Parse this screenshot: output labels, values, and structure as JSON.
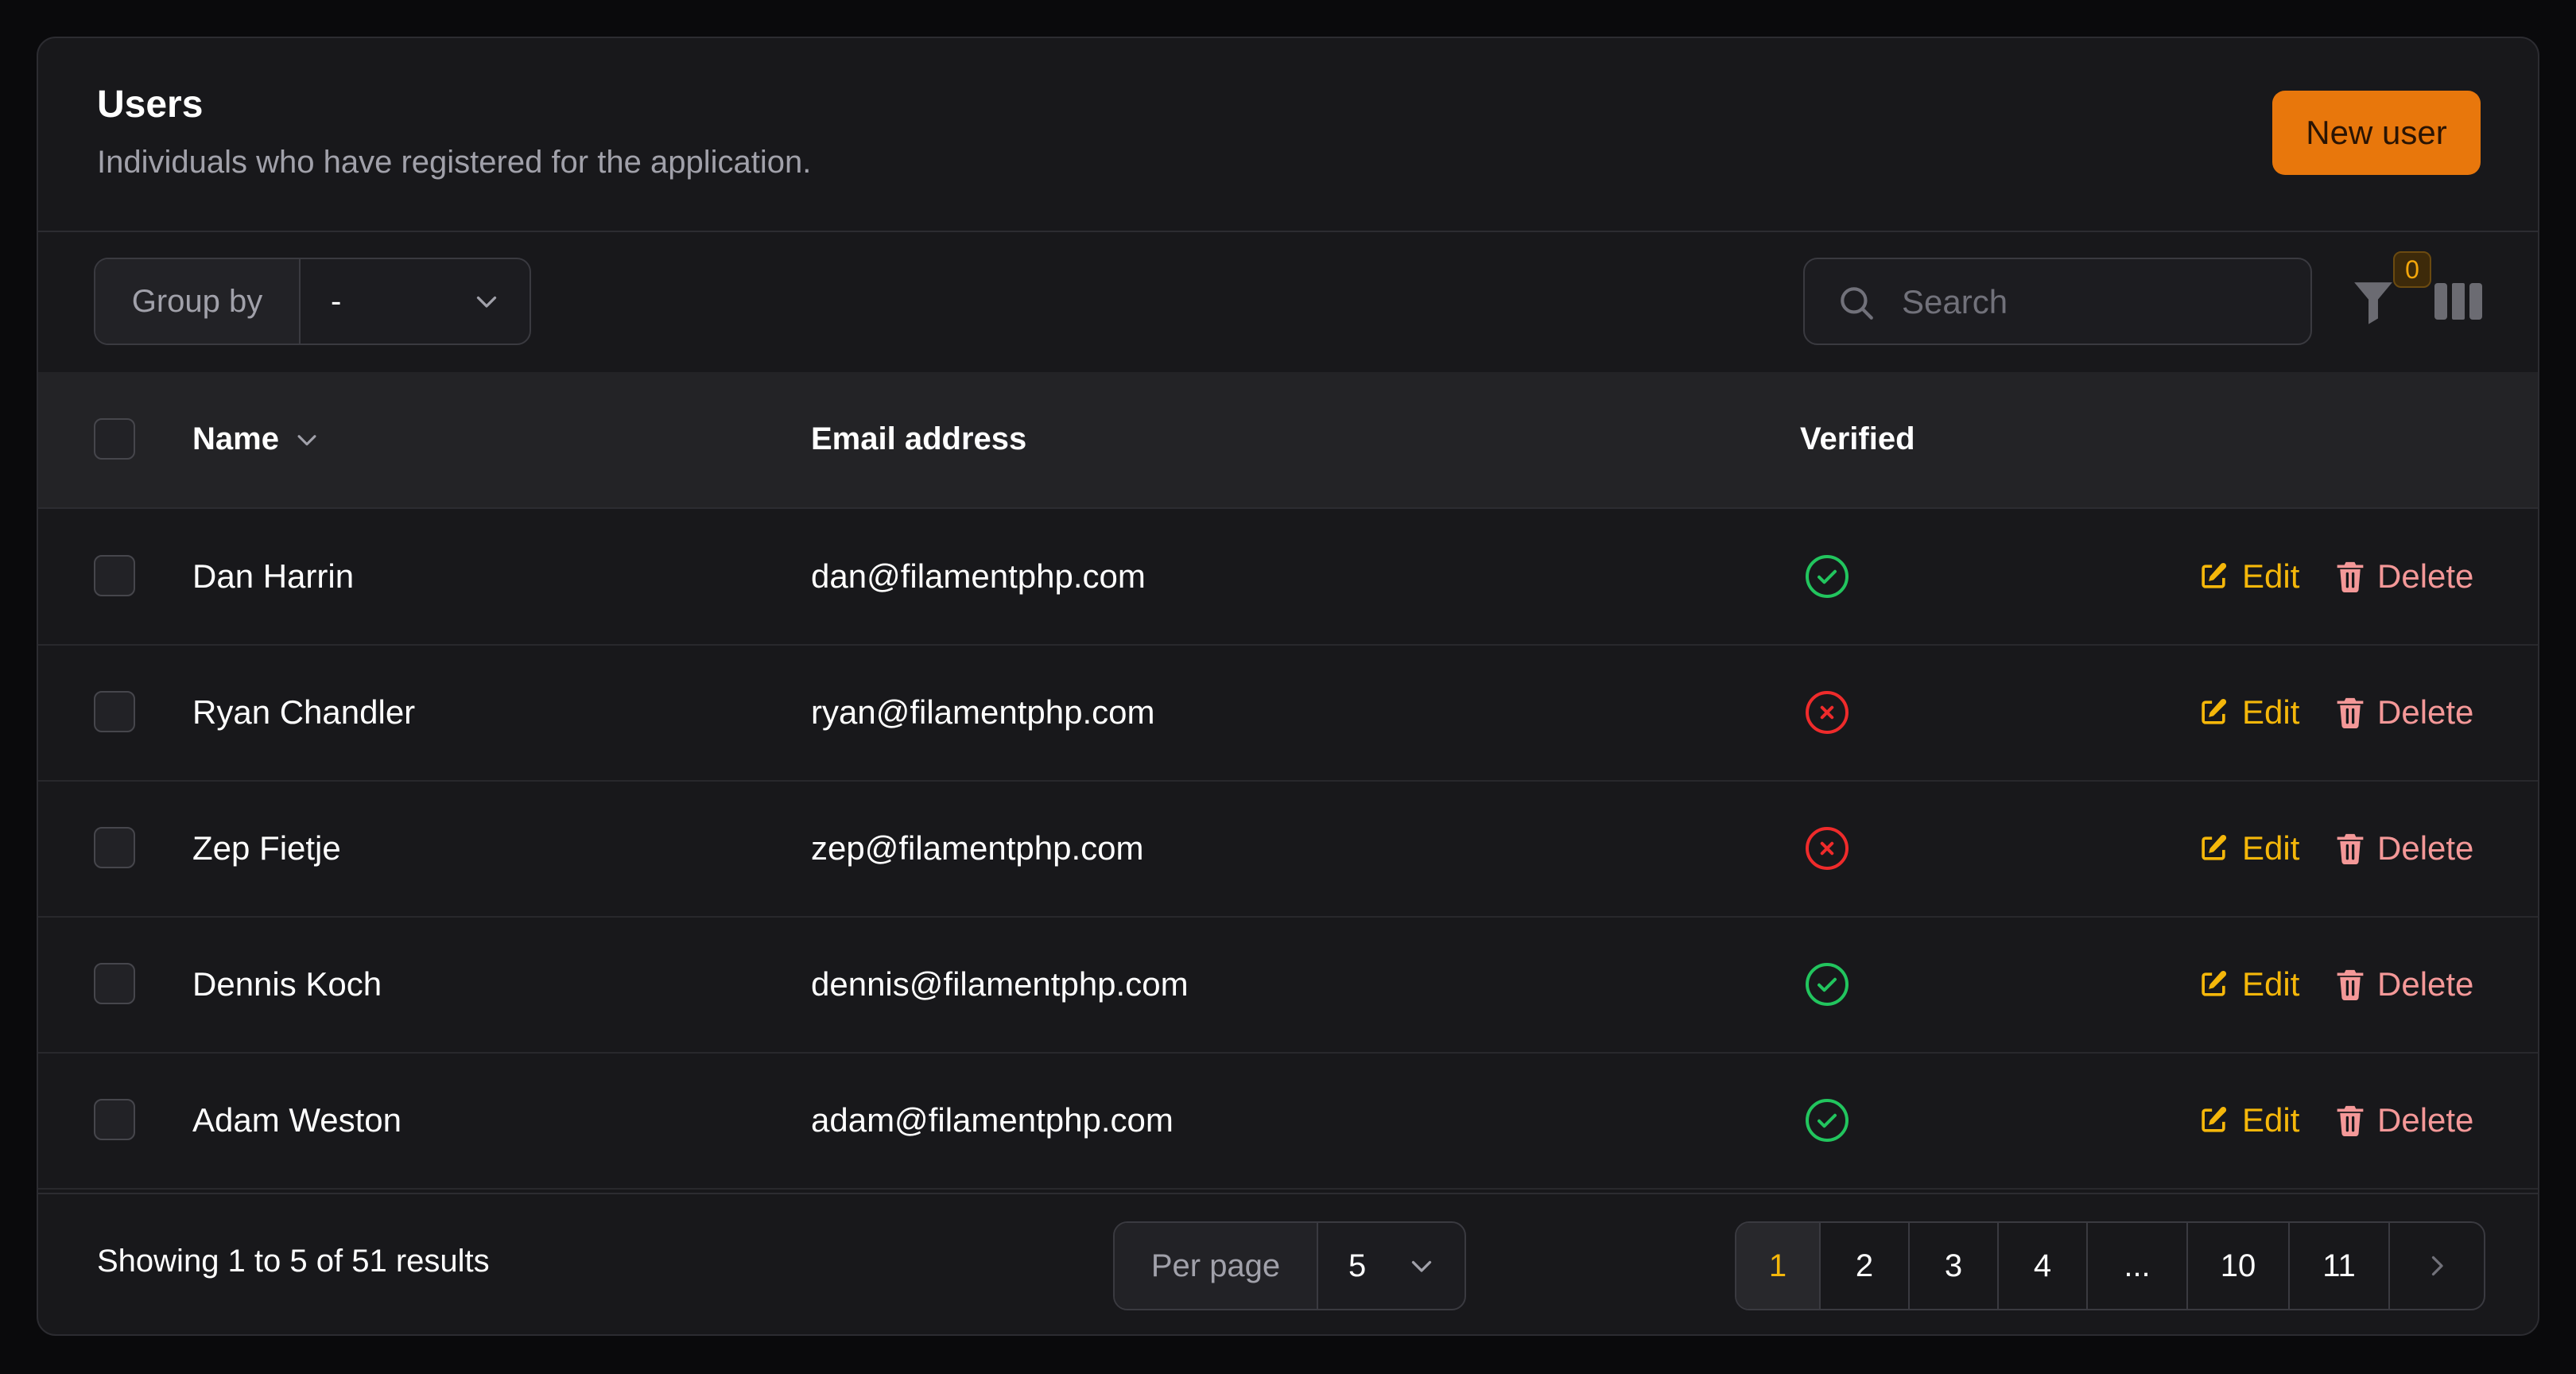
{
  "header": {
    "title": "Users",
    "subtitle": "Individuals who have registered for the application.",
    "new_button": "New user"
  },
  "toolbar": {
    "group_by_label": "Group by",
    "group_by_value": "-",
    "search_placeholder": "Search",
    "filter_count": "0"
  },
  "table": {
    "columns": [
      "Name",
      "Email address",
      "Verified"
    ],
    "actions": {
      "edit": "Edit",
      "delete": "Delete"
    },
    "rows": [
      {
        "name": "Dan Harrin",
        "email": "dan@filamentphp.com",
        "verified": true
      },
      {
        "name": "Ryan Chandler",
        "email": "ryan@filamentphp.com",
        "verified": false
      },
      {
        "name": "Zep Fietje",
        "email": "zep@filamentphp.com",
        "verified": false
      },
      {
        "name": "Dennis Koch",
        "email": "dennis@filamentphp.com",
        "verified": true
      },
      {
        "name": "Adam Weston",
        "email": "adam@filamentphp.com",
        "verified": true
      }
    ]
  },
  "footer": {
    "results_text": "Showing 1 to 5 of 51 results",
    "per_page_label": "Per page",
    "per_page_value": "5",
    "pages": [
      "1",
      "2",
      "3",
      "4",
      "...",
      "10",
      "11"
    ],
    "current_page": "1"
  },
  "colors": {
    "accent": "#e8770c",
    "action_edit": "#f5b70a",
    "action_delete": "#f49898",
    "verified_yes": "#22c55e",
    "verified_no": "#ef2b2b"
  }
}
